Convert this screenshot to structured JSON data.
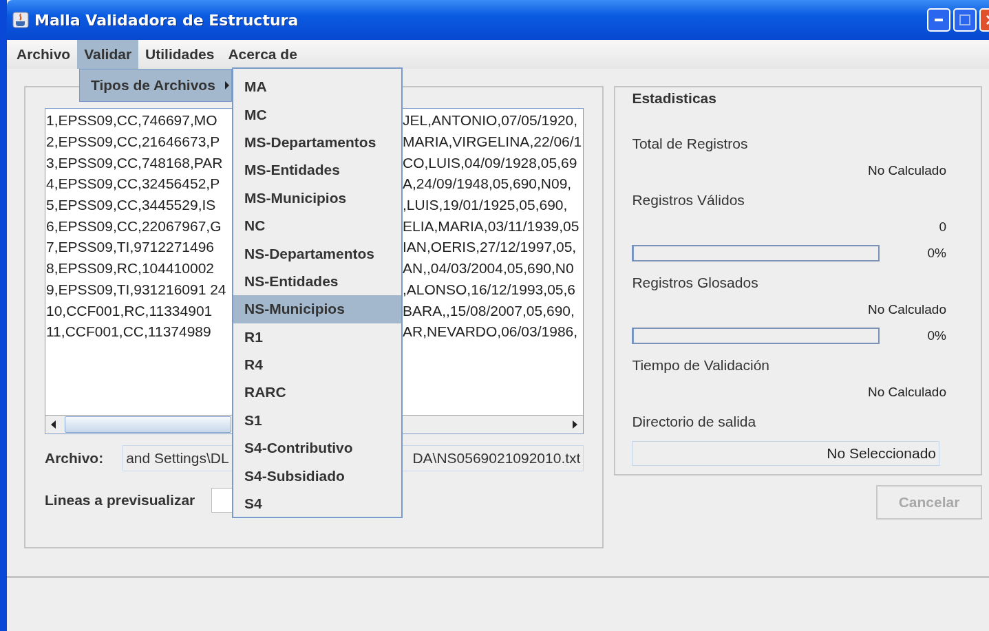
{
  "window": {
    "title": "Malla Validadora de Estructura"
  },
  "menu_bar": [
    {
      "label": "Archivo",
      "selected": false
    },
    {
      "label": "Validar",
      "selected": true
    },
    {
      "label": "Utilidades",
      "selected": false
    },
    {
      "label": "Acerca de",
      "selected": false
    }
  ],
  "validar_menu": {
    "items": [
      {
        "label": "Tipos de Archivos",
        "selected": true
      }
    ],
    "submenu": [
      {
        "label": "MA",
        "selected": false
      },
      {
        "label": "MC",
        "selected": false
      },
      {
        "label": "MS-Departamentos",
        "selected": false
      },
      {
        "label": "MS-Entidades",
        "selected": false
      },
      {
        "label": "MS-Municipios",
        "selected": false
      },
      {
        "label": "NC",
        "selected": false
      },
      {
        "label": "NS-Departamentos",
        "selected": false
      },
      {
        "label": "NS-Entidades",
        "selected": false
      },
      {
        "label": "NS-Municipios",
        "selected": true
      },
      {
        "label": "R1",
        "selected": false
      },
      {
        "label": "R4",
        "selected": false
      },
      {
        "label": "RARC",
        "selected": false
      },
      {
        "label": "S1",
        "selected": false
      },
      {
        "label": "S4-Contributivo",
        "selected": false
      },
      {
        "label": "S4-Subsidiado",
        "selected": false
      },
      {
        "label": "S4",
        "selected": false
      }
    ]
  },
  "preview": {
    "lines": [
      {
        "start": "1,EPSS09,CC,746697,MO",
        "end": "JEL,ANTONIO,07/05/1920,"
      },
      {
        "start": "2,EPSS09,CC,21646673,P",
        "end": "MARIA,VIRGELINA,22/06/1"
      },
      {
        "start": "3,EPSS09,CC,748168,PAR",
        "end": "CO,LUIS,04/09/1928,05,69"
      },
      {
        "start": "4,EPSS09,CC,32456452,P",
        "end": "A,24/09/1948,05,690,N09,"
      },
      {
        "start": "5,EPSS09,CC,3445529,IS",
        "end": ",LUIS,19/01/1925,05,690,"
      },
      {
        "start": "6,EPSS09,CC,22067967,G",
        "end": "ELIA,MARIA,03/11/1939,05"
      },
      {
        "start": "7,EPSS09,TI,9712271496",
        "end": "IAN,OERIS,27/12/1997,05,"
      },
      {
        "start": "8,EPSS09,RC,104410002",
        "end": "AN,,04/03/2004,05,690,N0"
      },
      {
        "start": "9,EPSS09,TI,931216091 24",
        "end": ",ALONSO,16/12/1993,05,6"
      },
      {
        "start": "10,CCF001,RC,11334901",
        "end": "BARA,,15/08/2007,05,690,"
      },
      {
        "start": "11,CCF001,CC,11374989",
        "end": "AR,NEVARDO,06/03/1986,"
      }
    ]
  },
  "file": {
    "label": "Archivo:",
    "value_start": "and Settings\\DL",
    "value_end": "DA\\NS0569021092010.txt"
  },
  "lines_preview": {
    "label": "Lineas a previsualizar"
  },
  "stats": {
    "title": "Estadisticas",
    "items": [
      {
        "kind": "label",
        "text": "Total de Registros"
      },
      {
        "kind": "value",
        "text": "No Calculado"
      },
      {
        "kind": "label",
        "text": "Registros Válidos"
      },
      {
        "kind": "value",
        "text": "0"
      },
      {
        "kind": "progress",
        "level": 0,
        "reading": "0%"
      },
      {
        "kind": "label",
        "text": "Registros Glosados"
      },
      {
        "kind": "value",
        "text": "No Calculado"
      },
      {
        "kind": "progress",
        "level": 0,
        "reading": "0%"
      },
      {
        "kind": "label",
        "text": "Tiempo de Validación"
      },
      {
        "kind": "value",
        "text": "No Calculado"
      },
      {
        "kind": "label",
        "text": "Directorio de salida"
      },
      {
        "kind": "field",
        "text": "No Seleccionado"
      }
    ]
  },
  "cancel_button": {
    "label": "Cancelar",
    "disabled": true
  }
}
